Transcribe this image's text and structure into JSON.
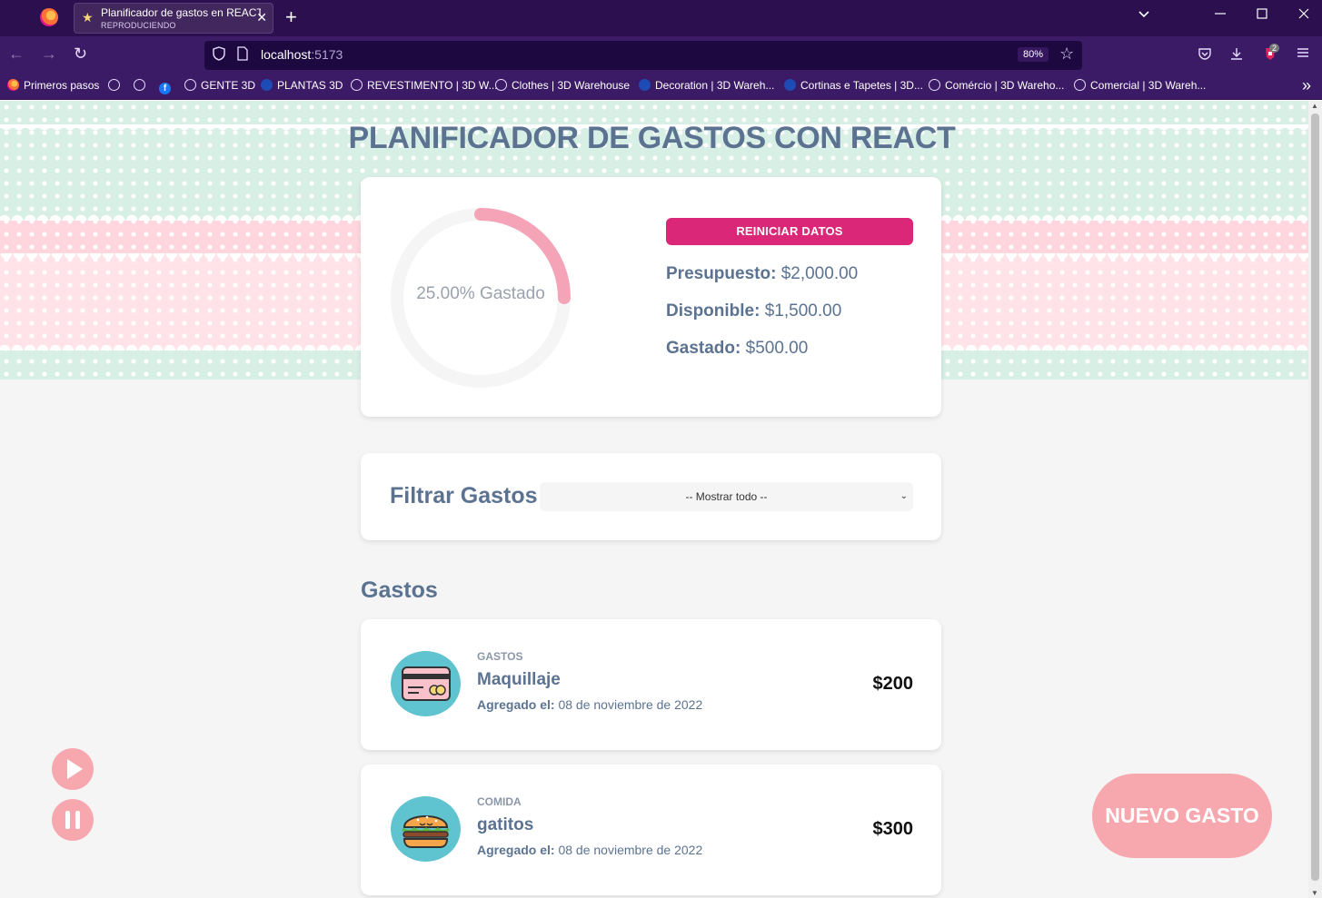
{
  "browser": {
    "tab_title": "Planificador de gastos en REACT",
    "tab_subtitle": "REPRODUCIENDO",
    "url_host": "localhost",
    "url_port": ":5173",
    "zoom": "80%",
    "extension_badge": "2",
    "bookmarks": [
      {
        "label": "Primeros pasos",
        "icon": "firefox-icon"
      },
      {
        "label": "",
        "icon": "globe-icon"
      },
      {
        "label": "",
        "icon": "globe-icon"
      },
      {
        "label": "",
        "icon": "facebook-icon"
      },
      {
        "label": "GENTE 3D",
        "icon": "globe-icon"
      },
      {
        "label": "PLANTAS 3D",
        "icon": "sketchup-icon"
      },
      {
        "label": "REVESTIMENTO | 3D W...",
        "icon": "globe-icon"
      },
      {
        "label": "Clothes | 3D Warehouse",
        "icon": "globe-icon"
      },
      {
        "label": "Decoration | 3D Wareh...",
        "icon": "sketchup-icon"
      },
      {
        "label": "Cortinas e Tapetes | 3D...",
        "icon": "sketchup-icon"
      },
      {
        "label": "Comércio | 3D Wareho...",
        "icon": "globe-icon"
      },
      {
        "label": "Comercial | 3D Wareh...",
        "icon": "globe-icon"
      }
    ]
  },
  "page": {
    "title": "PLANIFICADOR DE GASTOS CON REACT",
    "progress_label": "25.00% Gastado",
    "progress_fraction": 0.25,
    "reset_label": "REINICIAR DATOS",
    "budget_label": "Presupuesto:",
    "budget_value": "$2,000.00",
    "available_label": "Disponible:",
    "available_value": "$1,500.00",
    "spent_label": "Gastado:",
    "spent_value": "$500.00",
    "filter_label": "Filtrar Gastos",
    "filter_selected": "-- Mostrar todo --",
    "expenses_heading": "Gastos",
    "expenses": [
      {
        "category": "GASTOS",
        "name": "Maquillaje",
        "date_label": "Agregado el:",
        "date": "08 de noviembre de 2022",
        "amount": "$200",
        "icon": "credit-card-icon"
      },
      {
        "category": "COMIDA",
        "name": "gatitos",
        "date_label": "Agregado el:",
        "date": "08 de noviembre de 2022",
        "amount": "$300",
        "icon": "burger-icon"
      }
    ],
    "new_expense_label": "NUEVO GASTO"
  },
  "colors": {
    "accent": "#db2777",
    "progress": "#f5a3b7",
    "text": "#5b7391",
    "button_pink": "#f7a8ae"
  }
}
